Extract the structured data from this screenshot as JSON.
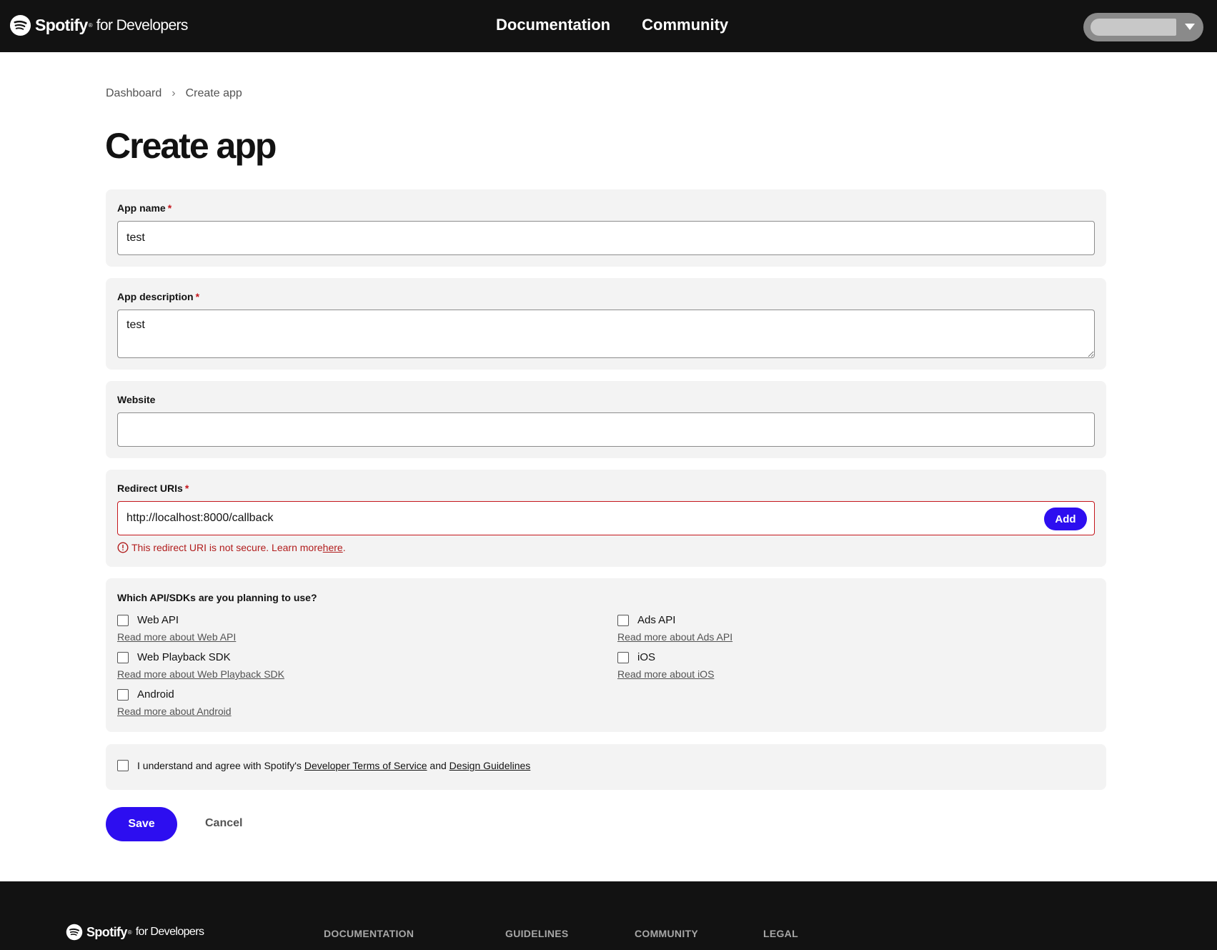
{
  "header": {
    "brand_name": "Spotify",
    "brand_suffix": "for Developers",
    "nav": [
      {
        "label": "Documentation"
      },
      {
        "label": "Community"
      }
    ]
  },
  "breadcrumb": {
    "items": [
      "Dashboard",
      "Create app"
    ],
    "separator": "›"
  },
  "page_title": "Create app",
  "form": {
    "required_marker": "*",
    "app_name": {
      "label": "App name",
      "value": "test"
    },
    "app_description": {
      "label": "App description",
      "value": "test"
    },
    "website": {
      "label": "Website",
      "value": ""
    },
    "redirect_uris": {
      "label": "Redirect URIs",
      "value": "http://localhost:8000/callback",
      "add_label": "Add",
      "error_text": "This redirect URI is not secure. Learn more ",
      "error_link": "here",
      "error_end": "."
    },
    "sdks": {
      "title": "Which API/SDKs are you planning to use?",
      "items": [
        {
          "label": "Web API",
          "link": "Read more about Web API"
        },
        {
          "label": "Ads API",
          "link": "Read more about Ads API"
        },
        {
          "label": "Web Playback SDK",
          "link": "Read more about Web Playback SDK"
        },
        {
          "label": "iOS",
          "link": "Read more about iOS"
        },
        {
          "label": "Android",
          "link": "Read more about Android"
        }
      ]
    },
    "terms": {
      "prefix": "I understand and agree with Spotify's ",
      "tos_link": "Developer Terms of Service",
      "and": " and ",
      "guidelines_link": "Design Guidelines"
    },
    "save_label": "Save",
    "cancel_label": "Cancel"
  },
  "footer": {
    "brand_name": "Spotify",
    "brand_suffix": "for Developers",
    "columns": [
      "DOCUMENTATION",
      "GUIDELINES",
      "COMMUNITY",
      "LEGAL"
    ]
  },
  "colors": {
    "accent": "#2d0ef0",
    "error": "#c4161c",
    "header_bg": "#121212",
    "card_bg": "#f3f3f3"
  },
  "icons": [
    "spotify-logo-icon",
    "chevron-down-icon",
    "breadcrumb-chevron-icon",
    "error-circle-icon"
  ]
}
